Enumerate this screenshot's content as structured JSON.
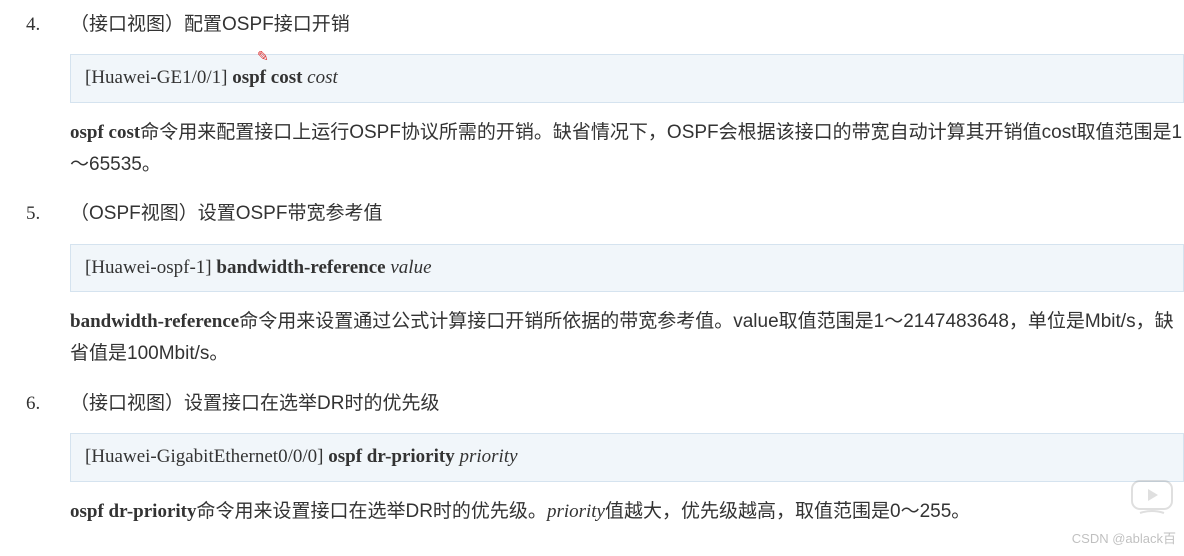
{
  "items": [
    {
      "num": "4.",
      "title_prefix": "（接口视图）配置OSPF接口开销",
      "code_prompt": "[Huawei-GE1/0/1] ",
      "code_bold": "ospf cost ",
      "code_italic": "cost",
      "desc_bold": "ospf cost",
      "desc_rest": "命令用来配置接口上运行OSPF协议所需的开销。缺省情况下，OSPF会根据该接口的带宽自动计算其开销值cost取值范围是1～65535。"
    },
    {
      "num": "5.",
      "title_prefix": "（OSPF视图）设置OSPF带宽参考值",
      "code_prompt": "[Huawei-ospf-1] ",
      "code_bold": "bandwidth-reference ",
      "code_italic": "value",
      "desc_bold": "bandwidth-reference",
      "desc_rest": "命令用来设置通过公式计算接口开销所依据的带宽参考值。value取值范围是1～2147483648，单位是Mbit/s，缺省值是100Mbit/s。"
    },
    {
      "num": "6.",
      "title_prefix": "（接口视图）设置接口在选举DR时的优先级",
      "code_prompt": "[Huawei-GigabitEthernet0/0/0] ",
      "code_bold": "ospf dr-priority ",
      "code_italic": "priority",
      "desc_bold": "ospf dr-priority",
      "desc_mid": "命令用来设置接口在选举DR时的优先级。",
      "desc_italic": "priority",
      "desc_end": "值越大，优先级越高，取值范围是0～255。"
    }
  ],
  "watermark": "CSDN @ablack百",
  "pen_mark": "✎"
}
